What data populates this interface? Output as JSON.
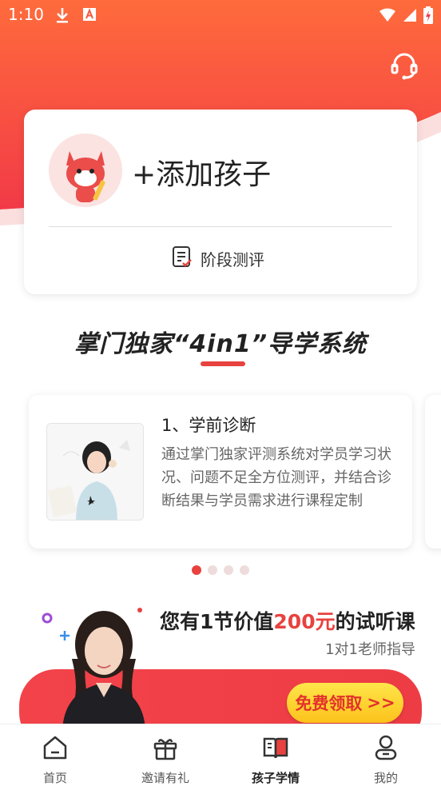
{
  "status_bar": {
    "time": "1:10"
  },
  "child_card": {
    "add_child_label": "+添加孩子",
    "stage_eval_label": "阶段测评"
  },
  "section": {
    "title": "掌门独家“4in1”导学系统"
  },
  "feature": {
    "title": "1、学前诊断",
    "description": "通过掌门独家评测系统对学员学习状况、问题不足全方位测评，并结合诊断结果与学员需求进行课程定制"
  },
  "carousel": {
    "page_count": 4,
    "active_index": 0
  },
  "promo": {
    "title_prefix": "您有1节价值",
    "title_highlight": "200元",
    "title_suffix": "的试听课",
    "subtitle": "1对1老师指导",
    "cta_label": "免费领取",
    "cta_arrow": ">>"
  },
  "tabs": [
    {
      "label": "首页",
      "icon": "home-icon",
      "active": false
    },
    {
      "label": "邀请有礼",
      "icon": "gift-icon",
      "active": false
    },
    {
      "label": "孩子学情",
      "icon": "book-icon",
      "active": true
    },
    {
      "label": "我的",
      "icon": "profile-icon",
      "active": false
    }
  ],
  "colors": {
    "accent": "#e8423f",
    "hero_top": "#ff6a3d",
    "hero_bottom": "#f0364a",
    "cta_yellow": "#ffd83a"
  }
}
